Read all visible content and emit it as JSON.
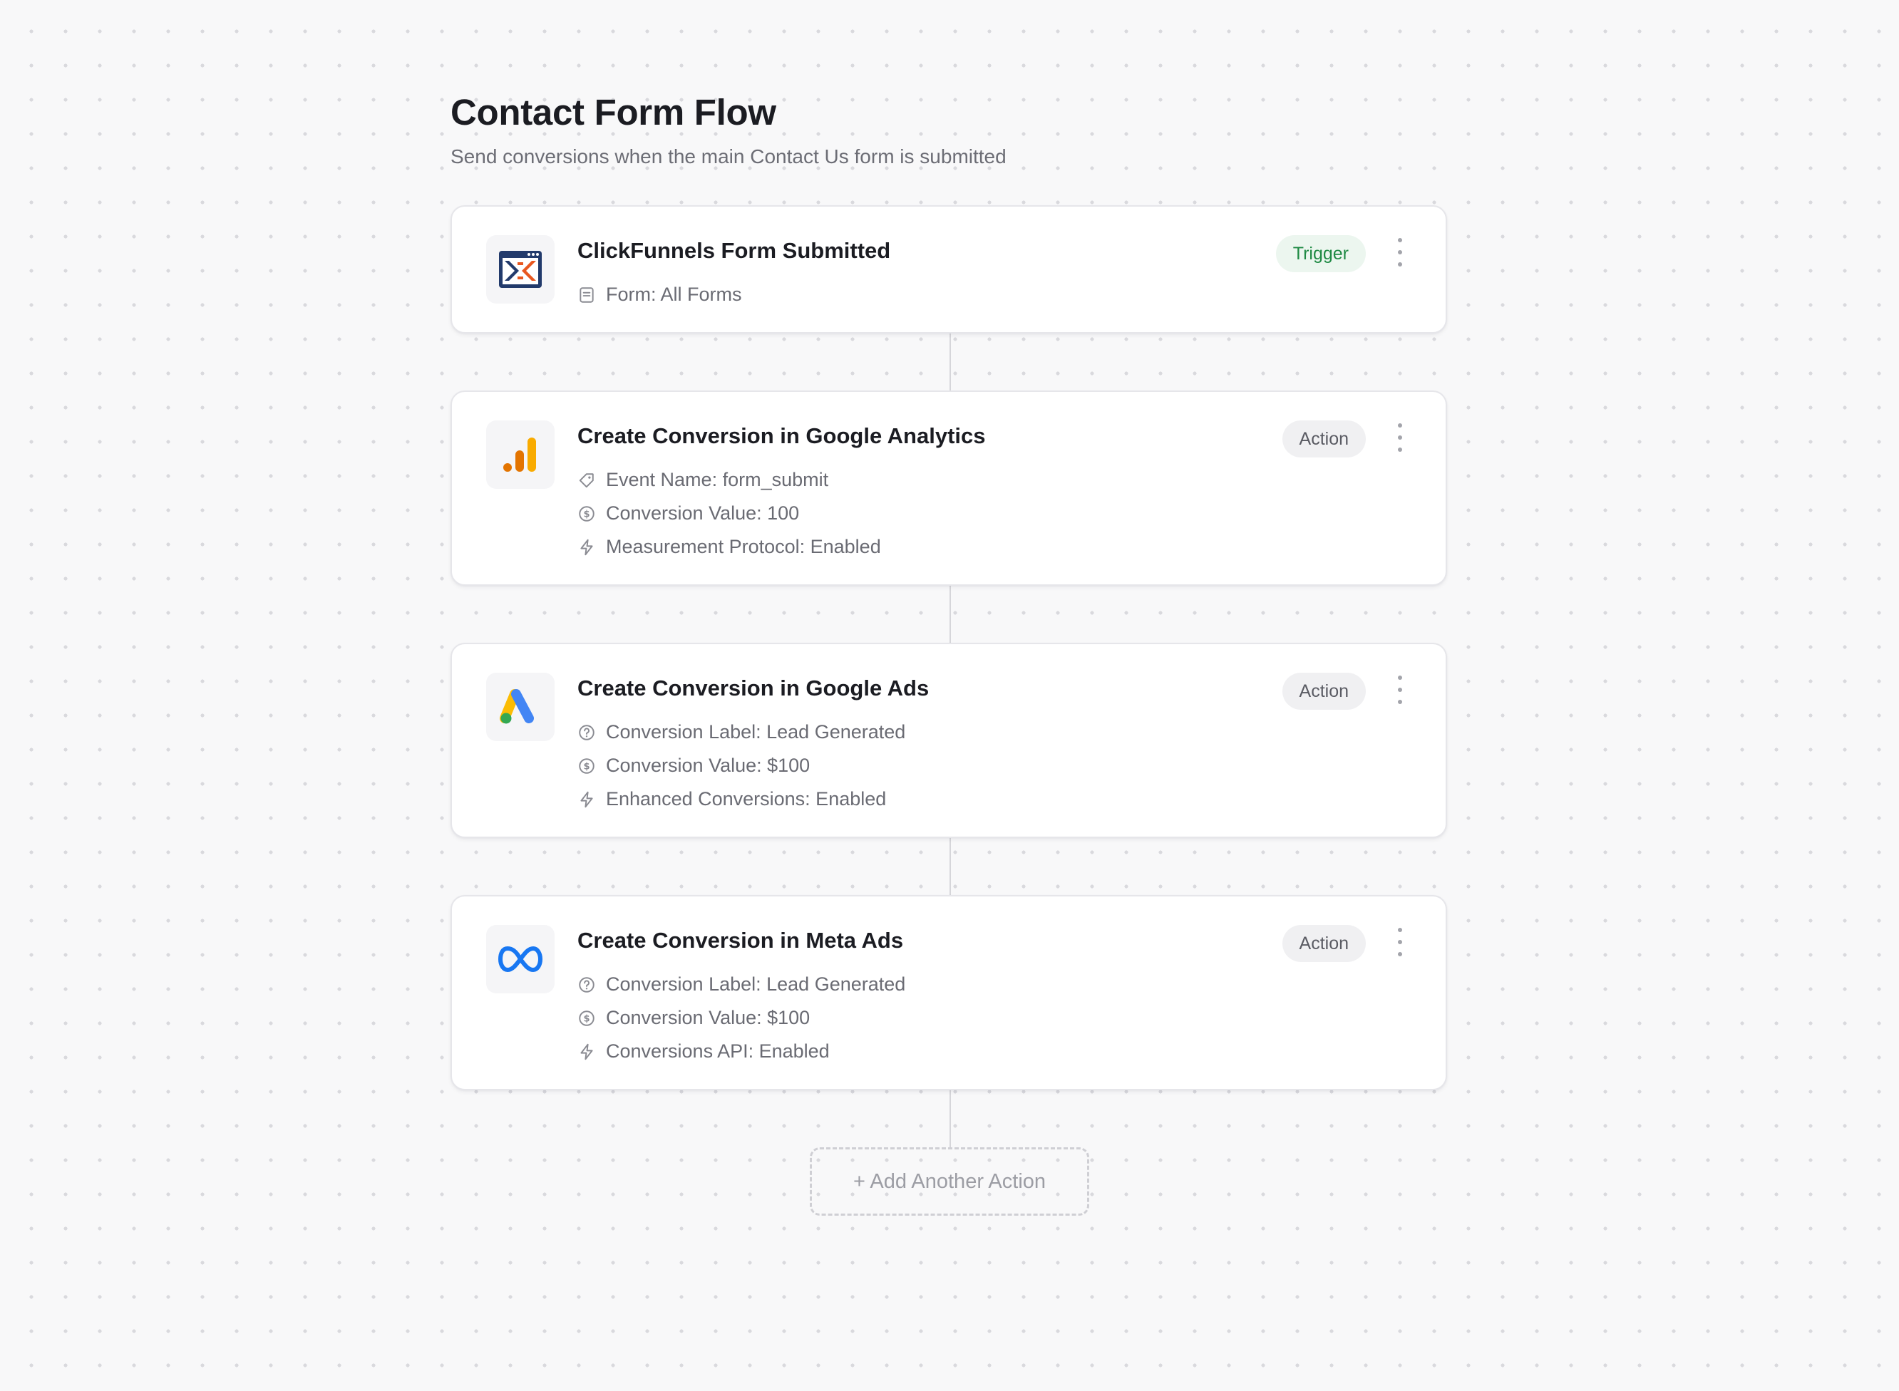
{
  "page": {
    "title": "Contact Form Flow",
    "subtitle": "Send conversions when the main Contact Us form is submitted"
  },
  "colors": {
    "trigger_badge_text": "#1f8a44",
    "trigger_badge_bg": "#ecf6ef",
    "action_badge_bg": "#f0f0f2",
    "clickfunnels_orange": "#e8571f",
    "clickfunnels_navy": "#223a6b",
    "analytics_orange": "#e37400",
    "analytics_yellow": "#f9ab00",
    "ads_blue": "#4285f4",
    "ads_yellow": "#fbbc04",
    "ads_green": "#34a853",
    "meta_blue": "#1877f2"
  },
  "steps": [
    {
      "title": "ClickFunnels Form Submitted",
      "badge": "Trigger",
      "icon": "clickfunnels-logo-icon",
      "props": [
        {
          "icon": "form-icon",
          "text": "Form: All Forms"
        }
      ]
    },
    {
      "title": "Create Conversion in Google Analytics",
      "badge": "Action",
      "icon": "google-analytics-logo-icon",
      "props": [
        {
          "icon": "tag-icon",
          "text": "Event Name: form_submit"
        },
        {
          "icon": "dollar-circle-icon",
          "text": "Conversion Value: 100"
        },
        {
          "icon": "lightning-icon",
          "text": "Measurement Protocol: Enabled"
        }
      ]
    },
    {
      "title": "Create Conversion in Google Ads",
      "badge": "Action",
      "icon": "google-ads-logo-icon",
      "props": [
        {
          "icon": "question-circle-icon",
          "text": "Conversion Label: Lead Generated"
        },
        {
          "icon": "dollar-circle-icon",
          "text": "Conversion Value: $100"
        },
        {
          "icon": "lightning-icon",
          "text": "Enhanced Conversions: Enabled"
        }
      ]
    },
    {
      "title": "Create Conversion in Meta Ads",
      "badge": "Action",
      "icon": "meta-logo-icon",
      "props": [
        {
          "icon": "question-circle-icon",
          "text": "Conversion Label: Lead Generated"
        },
        {
          "icon": "dollar-circle-icon",
          "text": "Conversion Value: $100"
        },
        {
          "icon": "lightning-icon",
          "text": "Conversions API: Enabled"
        }
      ]
    }
  ],
  "add_action_label": "+ Add Another Action"
}
